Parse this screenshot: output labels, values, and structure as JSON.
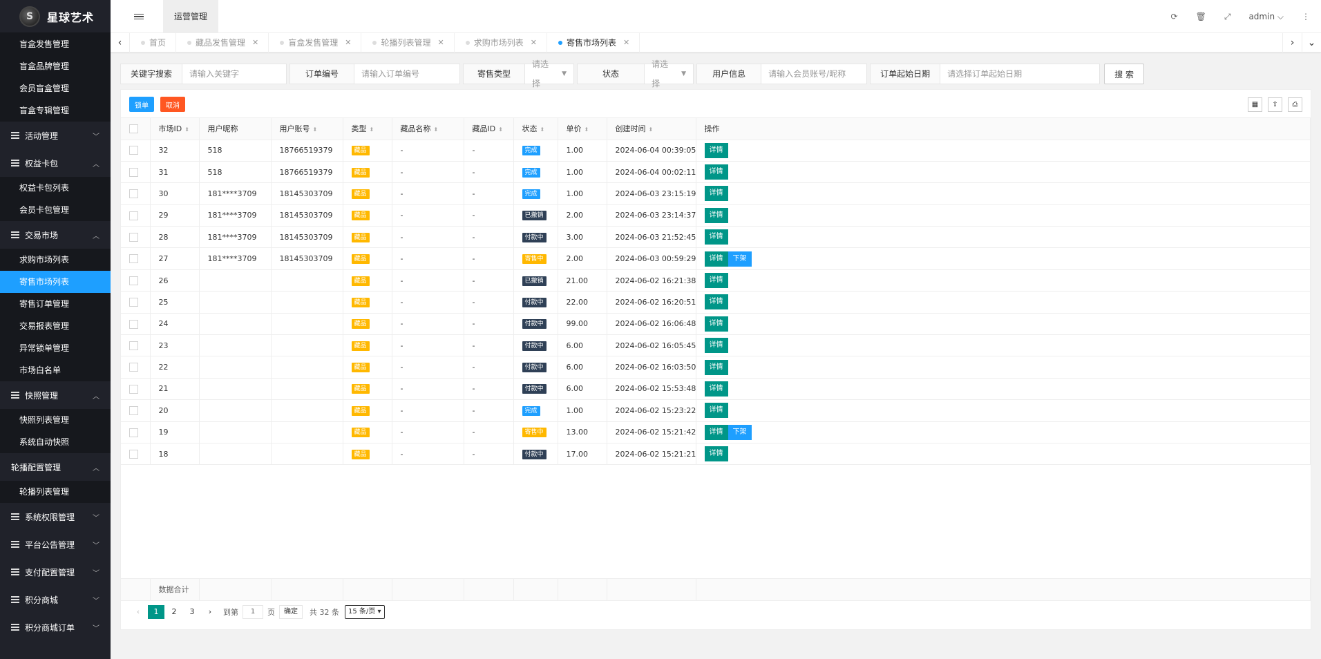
{
  "app": {
    "logo_mark": "S",
    "title": "星球艺术"
  },
  "sidebar": {
    "top_items": [
      {
        "label": "盲盒发售管理"
      },
      {
        "label": "盲盒品牌管理"
      },
      {
        "label": "会员盲盒管理"
      },
      {
        "label": "盲盒专辑管理"
      }
    ],
    "groups": [
      {
        "label": "活动管理",
        "open": false,
        "children": []
      },
      {
        "label": "权益卡包",
        "open": true,
        "children": [
          {
            "label": "权益卡包列表"
          },
          {
            "label": "会员卡包管理"
          }
        ]
      },
      {
        "label": "交易市场",
        "open": true,
        "children": [
          {
            "label": "求购市场列表"
          },
          {
            "label": "寄售市场列表",
            "active": true
          },
          {
            "label": "寄售订单管理"
          },
          {
            "label": "交易报表管理"
          },
          {
            "label": "异常锁单管理"
          },
          {
            "label": "市场白名单"
          }
        ]
      },
      {
        "label": "快照管理",
        "open": true,
        "children": [
          {
            "label": "快照列表管理"
          },
          {
            "label": "系统自动快照"
          }
        ]
      },
      {
        "label": "轮播配置管理",
        "open": true,
        "noicon": true,
        "children": [
          {
            "label": "轮播列表管理"
          }
        ]
      },
      {
        "label": "系统权限管理",
        "open": false,
        "children": []
      },
      {
        "label": "平台公告管理",
        "open": false,
        "children": []
      },
      {
        "label": "支付配置管理",
        "open": false,
        "children": []
      },
      {
        "label": "积分商城",
        "open": false,
        "children": []
      },
      {
        "label": "积分商城订单",
        "open": false,
        "children": []
      }
    ]
  },
  "header": {
    "top_tab": "运营管理",
    "user": "admin"
  },
  "tabs": [
    {
      "label": "首页",
      "closable": false,
      "active": false
    },
    {
      "label": "藏品发售管理",
      "closable": true,
      "active": false
    },
    {
      "label": "盲盒发售管理",
      "closable": true,
      "active": false
    },
    {
      "label": "轮播列表管理",
      "closable": true,
      "active": false
    },
    {
      "label": "求购市场列表",
      "closable": true,
      "active": false
    },
    {
      "label": "寄售市场列表",
      "closable": true,
      "active": true
    }
  ],
  "search": {
    "keyword": {
      "label": "关键字搜索",
      "placeholder": "请输入关键字"
    },
    "order_no": {
      "label": "订单编号",
      "placeholder": "请输入订单编号"
    },
    "consign_type": {
      "label": "寄售类型",
      "value": "请选择"
    },
    "status": {
      "label": "状态",
      "value": "请选择"
    },
    "user_info": {
      "label": "用户信息",
      "placeholder": "请输入会员账号/昵称"
    },
    "start_date": {
      "label": "订单起始日期",
      "placeholder": "请选择订单起始日期"
    },
    "button": "搜 索"
  },
  "toolbar": {
    "lock": "锁单",
    "cancel": "取消"
  },
  "table": {
    "columns": [
      "市场ID",
      "用户昵称",
      "用户账号",
      "类型",
      "藏品名称",
      "藏品ID",
      "状态",
      "单价",
      "创建时间",
      "操作"
    ],
    "rows": [
      {
        "id": "32",
        "nick": "518",
        "account": "18766519379",
        "type": "藏品",
        "name": "-",
        "cid": "-",
        "status": "完成",
        "status_color": "blue",
        "price": "1.00",
        "time": "2024-06-04 00:39:05",
        "ops": [
          "详情"
        ]
      },
      {
        "id": "31",
        "nick": "518",
        "account": "18766519379",
        "type": "藏品",
        "name": "-",
        "cid": "-",
        "status": "完成",
        "status_color": "blue",
        "price": "1.00",
        "time": "2024-06-04 00:02:11",
        "ops": [
          "详情"
        ]
      },
      {
        "id": "30",
        "nick": "181****3709",
        "account": "18145303709",
        "type": "藏品",
        "name": "-",
        "cid": "-",
        "status": "完成",
        "status_color": "blue",
        "price": "1.00",
        "time": "2024-06-03 23:15:19",
        "ops": [
          "详情"
        ]
      },
      {
        "id": "29",
        "nick": "181****3709",
        "account": "18145303709",
        "type": "藏品",
        "name": "-",
        "cid": "-",
        "status": "已撤销",
        "status_color": "dark",
        "price": "2.00",
        "time": "2024-06-03 23:14:37",
        "ops": [
          "详情"
        ]
      },
      {
        "id": "28",
        "nick": "181****3709",
        "account": "18145303709",
        "type": "藏品",
        "name": "-",
        "cid": "-",
        "status": "付款中",
        "status_color": "dark",
        "price": "3.00",
        "time": "2024-06-03 21:52:45",
        "ops": [
          "详情"
        ]
      },
      {
        "id": "27",
        "nick": "181****3709",
        "account": "18145303709",
        "type": "藏品",
        "name": "-",
        "cid": "-",
        "status": "寄售中",
        "status_color": "yellow",
        "price": "2.00",
        "time": "2024-06-03 00:59:29",
        "ops": [
          "详情",
          "下架"
        ]
      },
      {
        "id": "26",
        "nick": "",
        "account": "",
        "type": "藏品",
        "name": "-",
        "cid": "-",
        "status": "已撤销",
        "status_color": "dark",
        "price": "21.00",
        "time": "2024-06-02 16:21:38",
        "ops": [
          "详情"
        ]
      },
      {
        "id": "25",
        "nick": "",
        "account": "",
        "type": "藏品",
        "name": "-",
        "cid": "-",
        "status": "付款中",
        "status_color": "dark",
        "price": "22.00",
        "time": "2024-06-02 16:20:51",
        "ops": [
          "详情"
        ]
      },
      {
        "id": "24",
        "nick": "",
        "account": "",
        "type": "藏品",
        "name": "-",
        "cid": "-",
        "status": "付款中",
        "status_color": "dark",
        "price": "99.00",
        "time": "2024-06-02 16:06:48",
        "ops": [
          "详情"
        ]
      },
      {
        "id": "23",
        "nick": "",
        "account": "",
        "type": "藏品",
        "name": "-",
        "cid": "-",
        "status": "付款中",
        "status_color": "dark",
        "price": "6.00",
        "time": "2024-06-02 16:05:45",
        "ops": [
          "详情"
        ]
      },
      {
        "id": "22",
        "nick": "",
        "account": "",
        "type": "藏品",
        "name": "-",
        "cid": "-",
        "status": "付款中",
        "status_color": "dark",
        "price": "6.00",
        "time": "2024-06-02 16:03:50",
        "ops": [
          "详情"
        ]
      },
      {
        "id": "21",
        "nick": "",
        "account": "",
        "type": "藏品",
        "name": "-",
        "cid": "-",
        "status": "付款中",
        "status_color": "dark",
        "price": "6.00",
        "time": "2024-06-02 15:53:48",
        "ops": [
          "详情"
        ]
      },
      {
        "id": "20",
        "nick": "",
        "account": "",
        "type": "藏品",
        "name": "-",
        "cid": "-",
        "status": "完成",
        "status_color": "blue",
        "price": "1.00",
        "time": "2024-06-02 15:23:22",
        "ops": [
          "详情"
        ]
      },
      {
        "id": "19",
        "nick": "",
        "account": "",
        "type": "藏品",
        "name": "-",
        "cid": "-",
        "status": "寄售中",
        "status_color": "yellow",
        "price": "13.00",
        "time": "2024-06-02 15:21:42",
        "ops": [
          "详情",
          "下架"
        ]
      },
      {
        "id": "18",
        "nick": "",
        "account": "",
        "type": "藏品",
        "name": "-",
        "cid": "-",
        "status": "付款中",
        "status_color": "dark",
        "price": "17.00",
        "time": "2024-06-02 15:21:21",
        "ops": [
          "详情"
        ]
      }
    ],
    "total_label": "数据合计"
  },
  "pager": {
    "prev": "‹",
    "next": "›",
    "pages": [
      "1",
      "2",
      "3"
    ],
    "current": "1",
    "goto_label": "到第",
    "goto_value": "1",
    "page_unit": "页",
    "confirm": "确定",
    "total": "共 32 条",
    "page_size": "15 条/页"
  },
  "colors": {
    "accent": "#009688",
    "blue": "#1e9fff",
    "orange": "#ff5722",
    "yellow": "#ffb800",
    "dark": "#2f4056",
    "sidebar": "#20222a"
  }
}
